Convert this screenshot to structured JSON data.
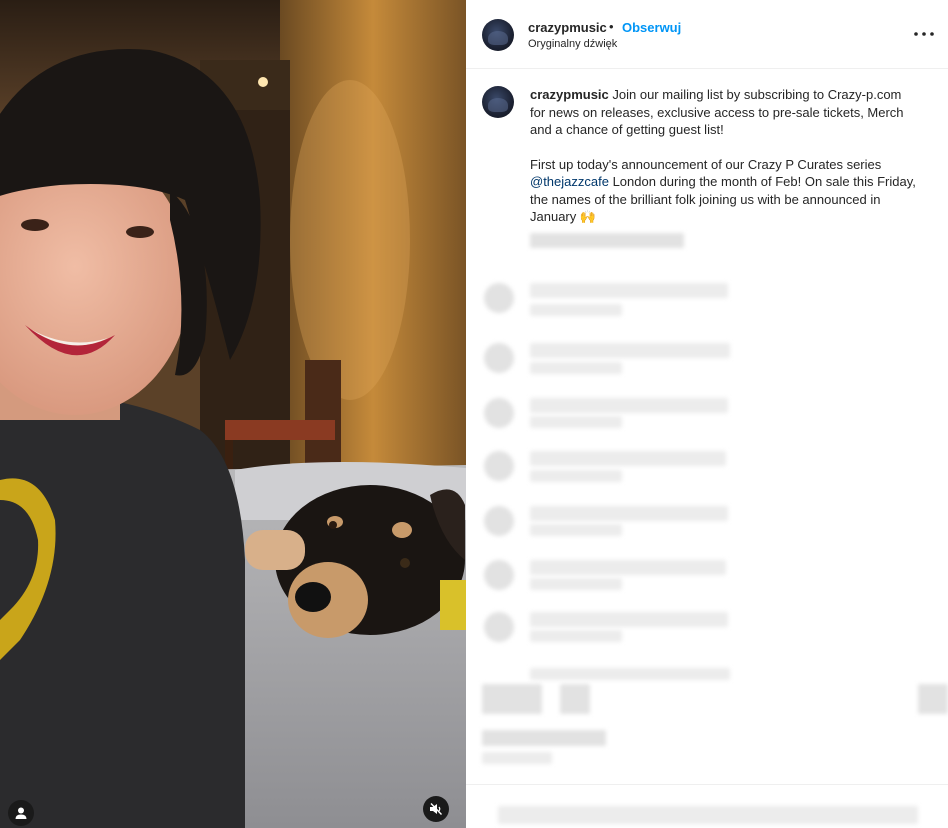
{
  "post": {
    "username": "crazypmusic",
    "separator": "•",
    "follow_label": "Obserwuj",
    "audio_label": "Oryginalny dźwięk",
    "more_label": "•••"
  },
  "caption": {
    "username": "crazypmusic",
    "para1": "Join our mailing list by subscribing to Crazy-p.com for news on releases, exclusive access to pre-sale tickets, Merch and a chance of getting guest list!",
    "para2_before": "First up today's announcement of our Crazy P Curates series ",
    "mention": "@thejazzcafe",
    "para2_after": " London during the month of Feb! On sale this Friday, the names of the brilliant folk joining us with be announced in January 🙌"
  },
  "media": {
    "user_tag_icon": "user-icon",
    "mute_icon": "speaker-muted-icon"
  }
}
